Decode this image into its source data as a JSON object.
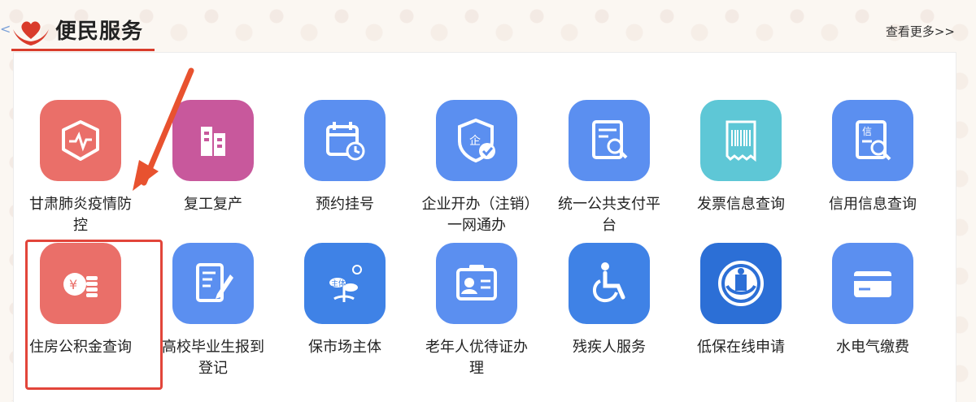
{
  "header": {
    "title": "便民服务",
    "more_label": "查看更多>>",
    "back_glyph": "<"
  },
  "colors": {
    "red": "#e8706c",
    "magenta": "#c8589c",
    "blue": "#5b8ff0",
    "teal": "#5ec7d6",
    "accent": "#d93b2b"
  },
  "tiles": [
    {
      "label": "甘肃肺炎疫情防控",
      "icon": "heartbeat-shield-icon",
      "color": "#ea6f69"
    },
    {
      "label": "复工复产",
      "icon": "buildings-icon",
      "color": "#c8589c"
    },
    {
      "label": "预约挂号",
      "icon": "calendar-clock-icon",
      "color": "#5b8ff0"
    },
    {
      "label": "企业开办（注销）一网通办",
      "icon": "enterprise-shield-icon",
      "color": "#5b8ff0"
    },
    {
      "label": "统一公共支付平台",
      "icon": "document-search-icon",
      "color": "#5b8ff0"
    },
    {
      "label": "发票信息查询",
      "icon": "receipt-barcode-icon",
      "color": "#5ec7d6"
    },
    {
      "label": "信用信息查询",
      "icon": "credit-search-icon",
      "color": "#5b8ff0"
    },
    {
      "label": "住房公积金查询",
      "icon": "coin-stack-icon",
      "color": "#ea6f69"
    },
    {
      "label": "高校毕业生报到登记",
      "icon": "notebook-pen-icon",
      "color": "#5b8ff0"
    },
    {
      "label": "保市场主体",
      "icon": "sprout-sun-icon",
      "color": "#3f82e6"
    },
    {
      "label": "老年人优待证办理",
      "icon": "id-card-icon",
      "color": "#5b8ff0"
    },
    {
      "label": "残疾人服务",
      "icon": "wheelchair-icon",
      "color": "#3f82e6"
    },
    {
      "label": "低保在线申请",
      "icon": "welfare-emblem-icon",
      "color": "#2c6fd6"
    },
    {
      "label": "水电气缴费",
      "icon": "payment-card-icon",
      "color": "#5b8ff0"
    }
  ]
}
